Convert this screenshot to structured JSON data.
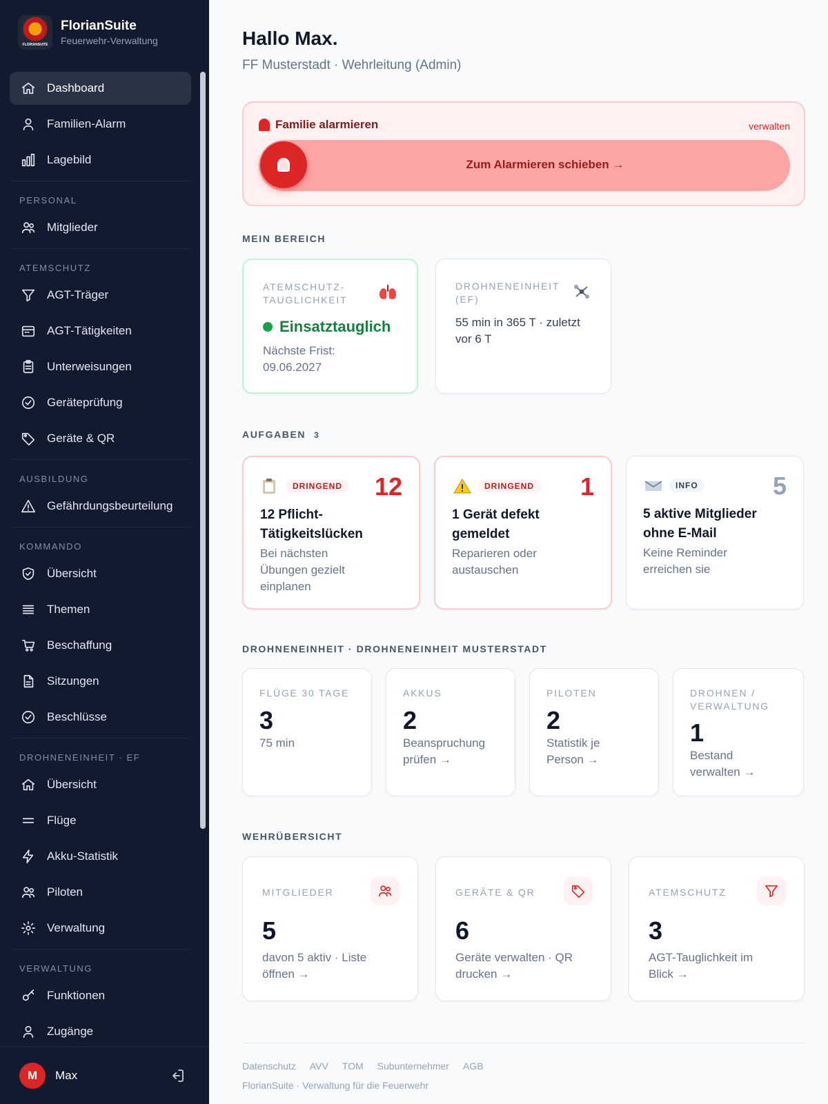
{
  "app": {
    "name": "FlorianSuite",
    "tagline": "Feuerwehr-Verwaltung",
    "logo_text": "FLORIANSUITE"
  },
  "nav": {
    "top": [
      {
        "label": "Dashboard",
        "icon": "home-icon",
        "active": true
      },
      {
        "label": "Familien-Alarm",
        "icon": "user-icon"
      },
      {
        "label": "Lagebild",
        "icon": "bar-chart-icon"
      }
    ],
    "sections": [
      {
        "title": "PERSONAL",
        "items": [
          {
            "label": "Mitglieder",
            "icon": "users-icon"
          }
        ]
      },
      {
        "title": "ATEMSCHUTZ",
        "items": [
          {
            "label": "AGT-Träger",
            "icon": "funnel-icon"
          },
          {
            "label": "AGT-Tätigkeiten",
            "icon": "calendar-icon"
          },
          {
            "label": "Unterweisungen",
            "icon": "clipboard-icon"
          },
          {
            "label": "Geräteprüfung",
            "icon": "check-circle-icon"
          },
          {
            "label": "Geräte & QR",
            "icon": "tag-icon"
          }
        ]
      },
      {
        "title": "AUSBILDUNG",
        "items": [
          {
            "label": "Gefährdungsbeurteilung",
            "icon": "warning-icon"
          }
        ]
      },
      {
        "title": "KOMMANDO",
        "items": [
          {
            "label": "Übersicht",
            "icon": "shield-check-icon"
          },
          {
            "label": "Themen",
            "icon": "list-icon"
          },
          {
            "label": "Beschaffung",
            "icon": "cart-icon"
          },
          {
            "label": "Sitzungen",
            "icon": "document-icon"
          },
          {
            "label": "Beschlüsse",
            "icon": "check-circle-icon"
          }
        ]
      },
      {
        "title": "DROHNENEINHEIT · EF",
        "items": [
          {
            "label": "Übersicht",
            "icon": "home-icon"
          },
          {
            "label": "Flüge",
            "icon": "menu-icon"
          },
          {
            "label": "Akku-Statistik",
            "icon": "bolt-icon"
          },
          {
            "label": "Piloten",
            "icon": "users-icon"
          },
          {
            "label": "Verwaltung",
            "icon": "gear-icon"
          }
        ]
      },
      {
        "title": "VERWALTUNG",
        "items": [
          {
            "label": "Funktionen",
            "icon": "key-icon"
          },
          {
            "label": "Zugänge",
            "icon": "user-icon"
          }
        ]
      }
    ]
  },
  "user": {
    "initial": "M",
    "name": "Max"
  },
  "header": {
    "greeting": "Hallo Max.",
    "subline": "FF Musterstadt · Wehrleitung (Admin)"
  },
  "alarm": {
    "title": "Familie alarmieren",
    "manage": "verwalten",
    "slider": "Zum Alarmieren schieben →"
  },
  "mein_bereich": {
    "label": "MEIN BEREICH",
    "atemschutz": {
      "label_l1": "ATEMSCHUTZ-",
      "label_l2": "TAUGLICHKEIT",
      "status": "Einsatztauglich",
      "deadline_l1": "Nächste Frist:",
      "deadline_l2": "09.06.2027"
    },
    "drohne": {
      "label_l1": "DROHNENEINHEIT",
      "label_l2": "(EF)",
      "text_l1": "55 min in 365 T · zuletzt",
      "text_l2": "vor 6 T"
    }
  },
  "aufgaben": {
    "label": "AUFGABEN",
    "count": "3",
    "cards": [
      {
        "badge": "DRINGEND",
        "num": "12",
        "title_l1": "12 Pflicht-",
        "title_l2": "Tätigkeitslücken",
        "text": [
          "Bei nächsten",
          "Übungen gezielt",
          "einplanen"
        ]
      },
      {
        "badge": "DRINGEND",
        "num": "1",
        "title_l1": "1 Gerät defekt",
        "title_l2": "gemeldet",
        "text": [
          "Reparieren oder",
          "austauschen"
        ]
      },
      {
        "badge": "INFO",
        "num": "5",
        "title_l1": "5 aktive Mitglieder",
        "title_l2": "ohne E-Mail",
        "text": [
          "Keine Reminder",
          "erreichen sie"
        ]
      }
    ]
  },
  "drohne": {
    "label": "DROHNENEINHEIT · DROHNENEINHEIT MUSTERSTADT",
    "stats": [
      {
        "label_l1": "FLÜGE 30 TAGE",
        "label_l2": "",
        "num": "3",
        "text_l1": "75 min",
        "text_l2": ""
      },
      {
        "label_l1": "AKKUS",
        "label_l2": "",
        "num": "2",
        "text_l1": "Beanspruchung",
        "text_l2": "prüfen →"
      },
      {
        "label_l1": "PILOTEN",
        "label_l2": "",
        "num": "2",
        "text_l1": "Statistik je",
        "text_l2": "Person →"
      },
      {
        "label_l1": "DROHNEN /",
        "label_l2": "VERWALTUNG",
        "num": "1",
        "text_l1": "Bestand",
        "text_l2": "verwalten →"
      }
    ]
  },
  "wehr": {
    "label": "WEHRÜBERSICHT",
    "cards": [
      {
        "label": "MITGLIEDER",
        "icon": "users-icon",
        "num": "5",
        "text_l1": "davon 5 aktiv · Liste",
        "text_l2": "öffnen →"
      },
      {
        "label": "GERÄTE & QR",
        "icon": "tag-icon",
        "num": "6",
        "text_l1": "Geräte verwalten · QR",
        "text_l2": "drucken →"
      },
      {
        "label": "ATEMSCHUTZ",
        "icon": "funnel-icon",
        "num": "3",
        "text_l1": "AGT-Tauglichkeit im",
        "text_l2": "Blick →"
      }
    ]
  },
  "footer": {
    "links": [
      "Datenschutz",
      "AVV",
      "TOM",
      "Subunternehmer",
      "AGB"
    ],
    "tagline": "FlorianSuite · Verwaltung für die Feuerwehr"
  },
  "colors": {
    "sidebar": "#111a2e",
    "accent": "#dc2626",
    "success": "#16a34a"
  }
}
